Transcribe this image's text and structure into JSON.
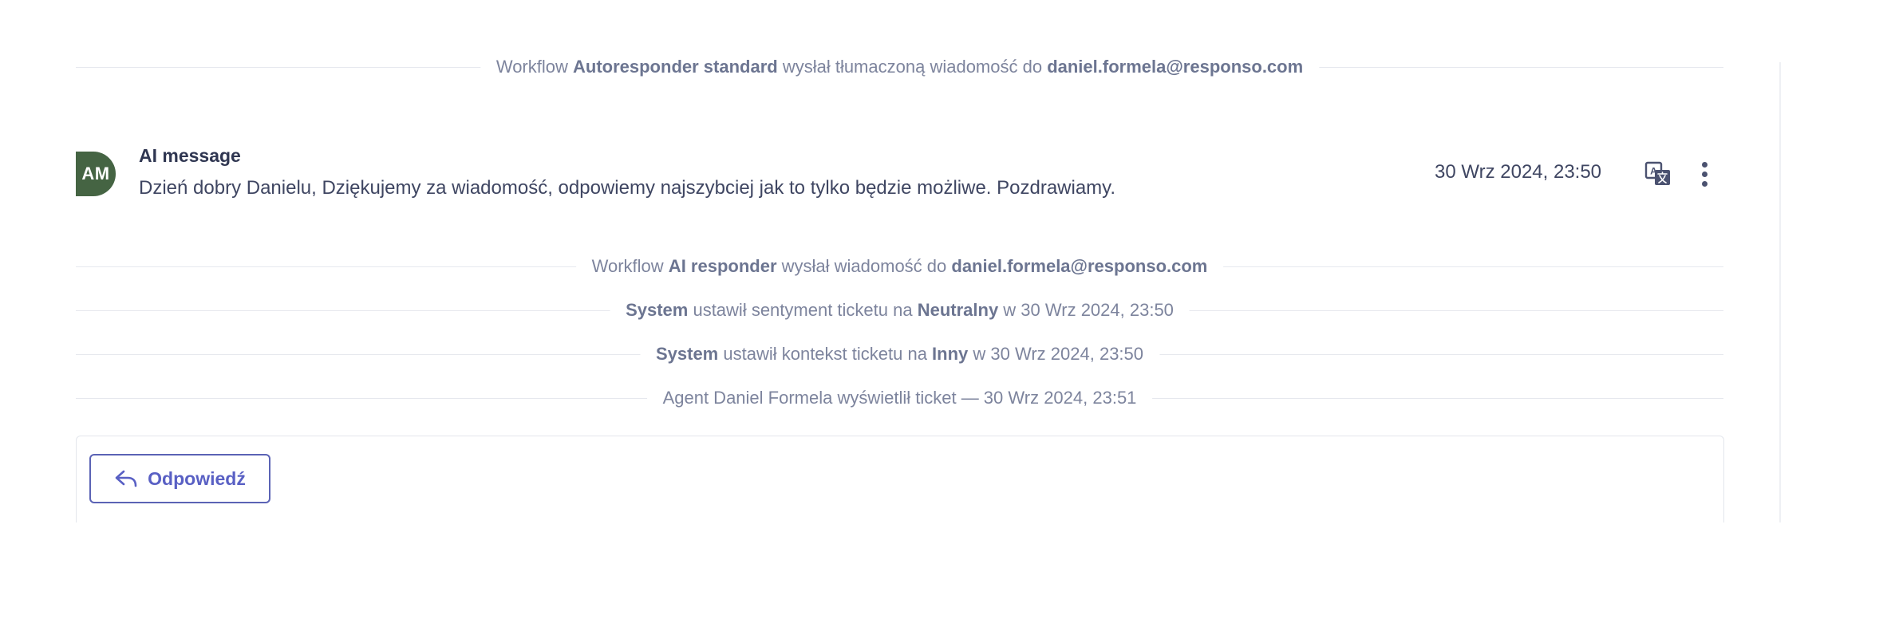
{
  "events": [
    {
      "prefix": "Workflow ",
      "b1": "Autoresponder standard",
      "middle": " wysłał tłumaczoną wiadomość do ",
      "b2": "daniel.formela@responso.com",
      "suffix": ""
    },
    {
      "prefix": "Workflow ",
      "b1": "AI responder",
      "middle": " wysłał wiadomość do ",
      "b2": "daniel.formela@responso.com",
      "suffix": ""
    },
    {
      "prefix": "",
      "b1": "System",
      "middle": " ustawił sentyment ticketu na ",
      "b2": "Neutralny",
      "suffix": " w 30 Wrz 2024, 23:50"
    },
    {
      "prefix": "",
      "b1": "System",
      "middle": " ustawił kontekst ticketu na ",
      "b2": "Inny",
      "suffix": " w 30 Wrz 2024, 23:50"
    },
    {
      "prefix": "Agent Daniel Formela wyświetlił ticket — 30 Wrz 2024, 23:51",
      "b1": "",
      "middle": "",
      "b2": "",
      "suffix": ""
    }
  ],
  "message": {
    "avatar_initials": "AM",
    "avatar_color": "#456443",
    "author": "AI message",
    "body": "Dzień dobry Danielu, Dziękujemy za wiadomość, odpowiemy najszybciej jak to tylko będzie możliwe. Pozdrawiamy.",
    "timestamp": "30 Wrz 2024, 23:50",
    "translate_icon": "translate-icon",
    "more_icon": "more-vertical-icon"
  },
  "reply": {
    "label": "Odpowiedź",
    "icon": "reply-arrow-icon",
    "accent": "#5960c4"
  }
}
